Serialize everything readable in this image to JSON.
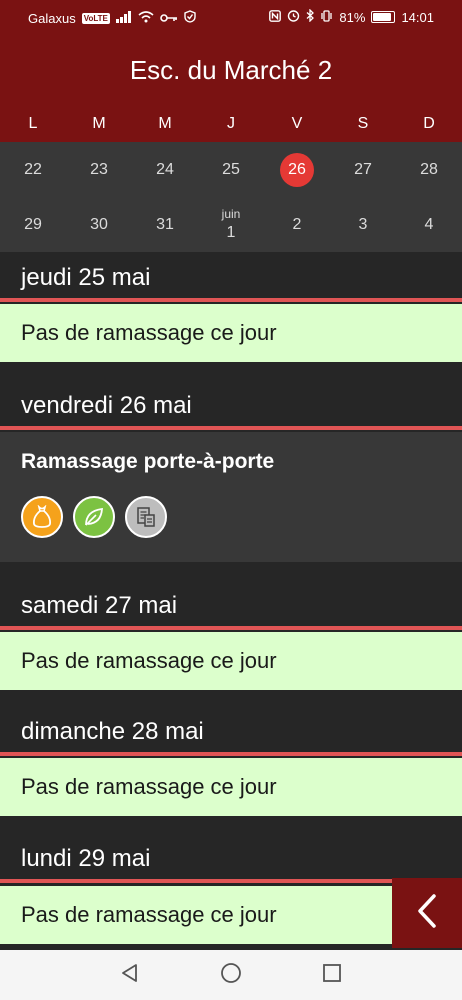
{
  "status_bar": {
    "carrier": "Galaxus",
    "volte": "VoLTE",
    "battery": "81%",
    "battery_level": 0.81,
    "time": "14:01"
  },
  "header": {
    "title": "Esc. du Marché 2"
  },
  "weekdays": [
    "L",
    "M",
    "M",
    "J",
    "V",
    "S",
    "D"
  ],
  "calendar": {
    "row1": [
      "22",
      "23",
      "24",
      "25",
      "26",
      "27",
      "28"
    ],
    "row2": [
      "29",
      "30",
      "31",
      "1",
      "2",
      "3",
      "4"
    ],
    "month_change_label": "juin",
    "selected": "26"
  },
  "days": [
    {
      "label": "jeudi 25 mai",
      "message": "Pas de ramassage ce jour"
    },
    {
      "label": "vendredi 26 mai",
      "pickup_title": "Ramassage porte-à-porte",
      "icons": [
        "household-waste-bag-icon",
        "green-waste-leaf-icon",
        "paper-cardboard-icon"
      ]
    },
    {
      "label": "samedi 27 mai",
      "message": "Pas de ramassage ce jour"
    },
    {
      "label": "dimanche 28 mai",
      "message": "Pas de ramassage ce jour"
    },
    {
      "label": "lundi 29 mai",
      "message": "Pas de ramassage ce jour"
    }
  ]
}
